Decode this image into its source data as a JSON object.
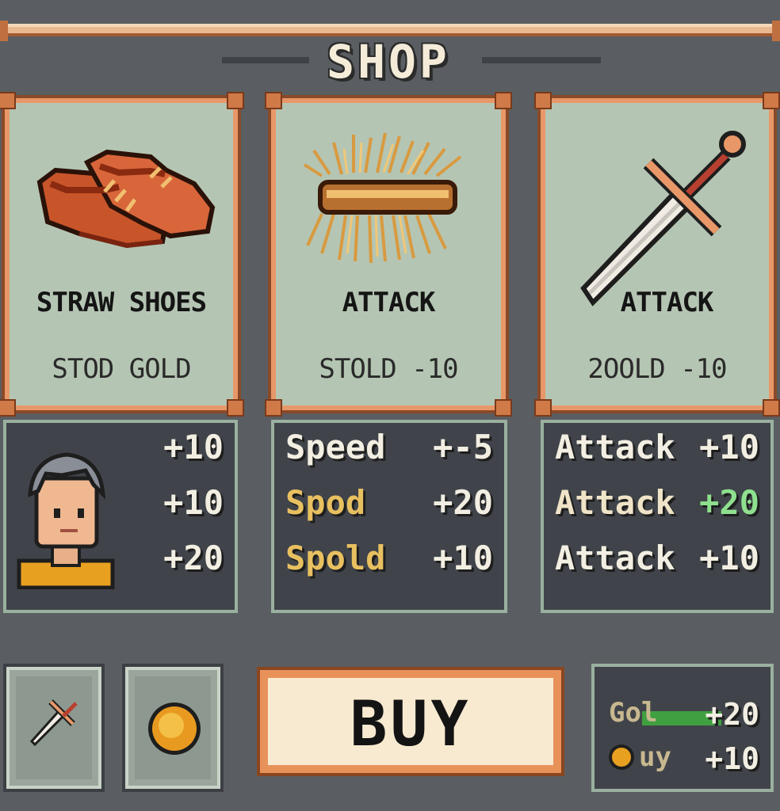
{
  "header": {
    "title": "SHOP"
  },
  "items": [
    {
      "name": "STRAW SHOES",
      "price": "STOD GOLD",
      "icon": "shoes-icon"
    },
    {
      "name": "ATTACK",
      "price": "STOLD -10",
      "icon": "straw-bundle-icon"
    },
    {
      "name": "ATTACK",
      "price": "2OOLD -10",
      "icon": "sword-icon"
    }
  ],
  "stats": {
    "hero": {
      "avatar": "hero-portrait",
      "values": [
        "+10",
        "+10",
        "+20"
      ]
    },
    "straw": [
      {
        "label": "Speed",
        "value": "+-5"
      },
      {
        "label": "Spod",
        "value": "+20"
      },
      {
        "label": "Spold",
        "value": "+10"
      }
    ],
    "sword": [
      {
        "label": "Attack",
        "value": "+10"
      },
      {
        "label": "Attack",
        "value": "+20"
      },
      {
        "label": "Attack",
        "value": "+10"
      }
    ]
  },
  "footer": {
    "slots": [
      {
        "icon": "sword-icon"
      },
      {
        "icon": "gold-coin-icon"
      }
    ],
    "buy_label": "BUY",
    "summary": [
      {
        "label": "Gol",
        "value": "+20"
      },
      {
        "label": "uy",
        "value": "+10"
      }
    ]
  },
  "colors": {
    "background": "#5a5e62",
    "card": "#b5c5b3",
    "card_border": "#e89868",
    "stat_panel": "#40444a",
    "gold_text": "#e8c060",
    "green_text": "#8ee08e"
  }
}
